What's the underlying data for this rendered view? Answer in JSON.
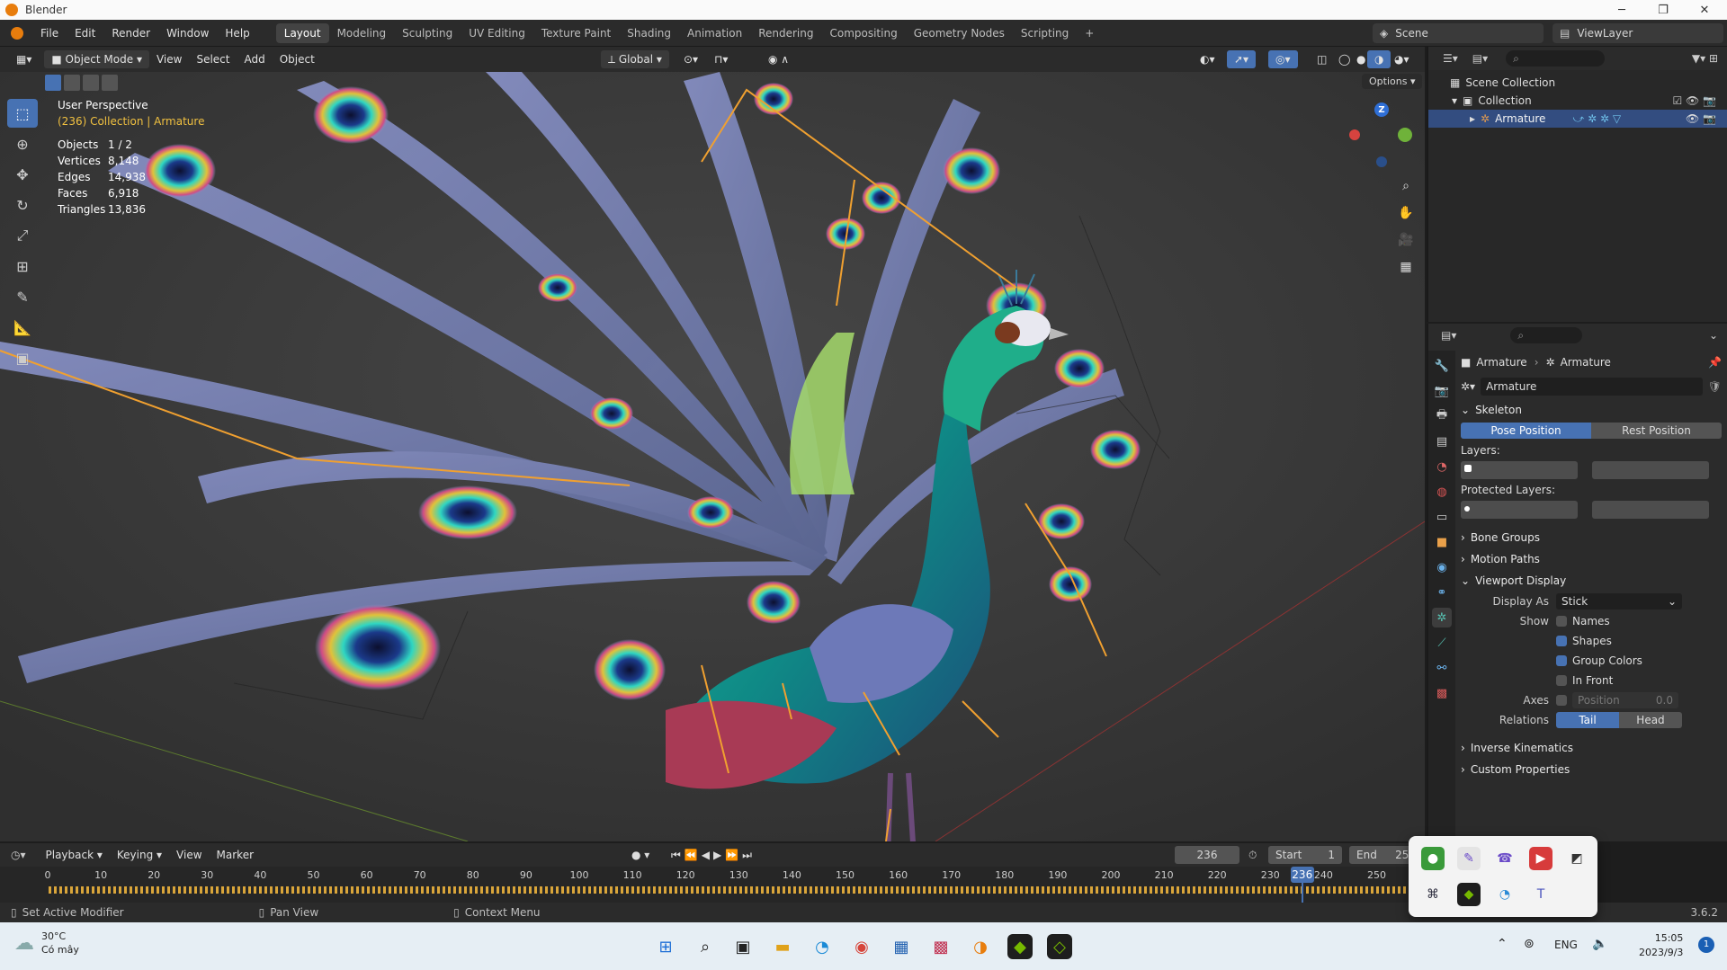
{
  "window": {
    "title": "Blender"
  },
  "menu": [
    "File",
    "Edit",
    "Render",
    "Window",
    "Help"
  ],
  "workspaces": [
    "Layout",
    "Modeling",
    "Sculpting",
    "UV Editing",
    "Texture Paint",
    "Shading",
    "Animation",
    "Rendering",
    "Compositing",
    "Geometry Nodes",
    "Scripting"
  ],
  "workspace_add": "+",
  "scene": {
    "name": "Scene",
    "view_layer": "ViewLayer"
  },
  "viewport_header": {
    "mode": "Object Mode",
    "menus": [
      "View",
      "Select",
      "Add",
      "Object"
    ],
    "orientation": "Global",
    "options": "Options"
  },
  "viewport": {
    "perspective": "User Perspective",
    "context": "(236) Collection | Armature",
    "stats": [
      {
        "label": "Objects",
        "value": "1 / 2"
      },
      {
        "label": "Vertices",
        "value": "8,148"
      },
      {
        "label": "Edges",
        "value": "14,938"
      },
      {
        "label": "Faces",
        "value": "6,918"
      },
      {
        "label": "Triangles",
        "value": "13,836"
      }
    ],
    "gizmo_z": "Z"
  },
  "outliner": {
    "scene_collection": "Scene Collection",
    "collection": "Collection",
    "armature": "Armature"
  },
  "properties": {
    "breadcrumb": [
      "Armature",
      "Armature"
    ],
    "data_name": "Armature",
    "skeleton": "Skeleton",
    "pose_position": "Pose Position",
    "rest_position": "Rest Position",
    "layers": "Layers:",
    "protected_layers": "Protected Layers:",
    "bone_groups": "Bone Groups",
    "motion_paths": "Motion Paths",
    "viewport_display": "Viewport Display",
    "display_as_label": "Display As",
    "display_as_value": "Stick",
    "show_label": "Show",
    "names": "Names",
    "shapes": "Shapes",
    "group_colors": "Group Colors",
    "in_front": "In Front",
    "axes_label": "Axes",
    "position_label": "Position",
    "position_value": "0.0",
    "relations_label": "Relations",
    "tail": "Tail",
    "head": "Head",
    "inverse_kinematics": "Inverse Kinematics",
    "custom_properties": "Custom Properties"
  },
  "timeline": {
    "menus": [
      "Playback",
      "Keying",
      "View",
      "Marker"
    ],
    "current_frame": "236",
    "start_label": "Start",
    "start": "1",
    "end_label": "End",
    "end": "250",
    "ruler": [
      "0",
      "10",
      "20",
      "30",
      "40",
      "50",
      "60",
      "70",
      "80",
      "90",
      "100",
      "110",
      "120",
      "130",
      "140",
      "150",
      "160",
      "170",
      "180",
      "190",
      "200",
      "210",
      "220",
      "230",
      "240",
      "250"
    ]
  },
  "statusbar": {
    "items": [
      "Set Active Modifier",
      "Pan View",
      "Context Menu"
    ],
    "version": "3.6.2"
  },
  "taskbar": {
    "weather_temp": "30°C",
    "weather_desc": "Có mây",
    "lang": "ENG",
    "time": "15:05",
    "date": "2023/9/3",
    "notification_count": "1"
  }
}
